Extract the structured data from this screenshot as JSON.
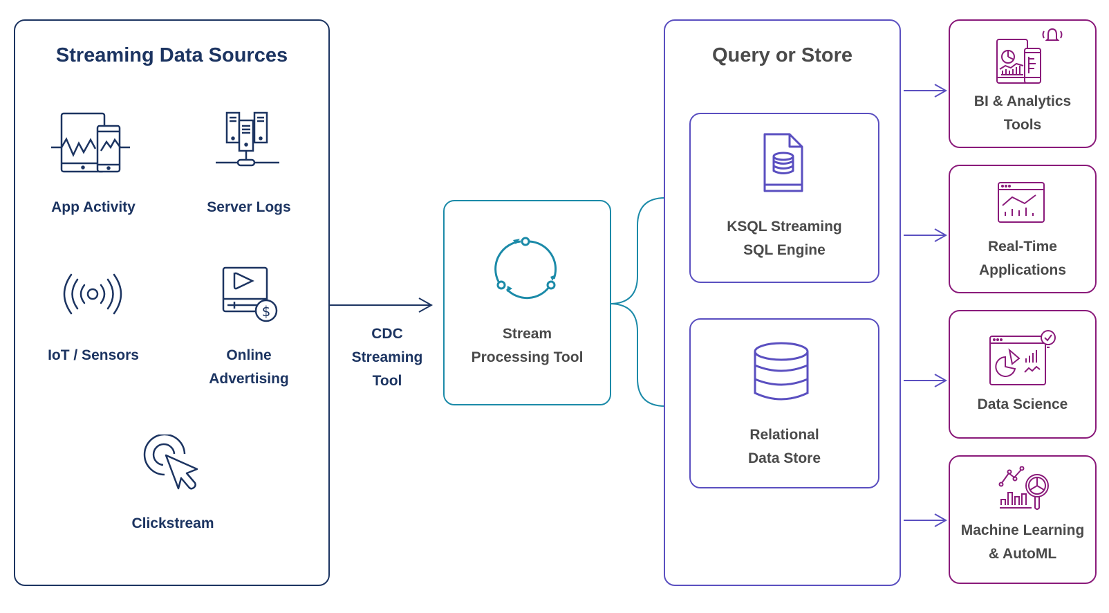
{
  "colors": {
    "navy": "#1c3461",
    "teal": "#1b8aa8",
    "indigo": "#5a4fc0",
    "purple": "#8a1a7a",
    "text_gray": "#4a4a4a"
  },
  "sources": {
    "title": "Streaming Data Sources",
    "items": [
      {
        "label": "App Activity",
        "icon": "app-activity-icon"
      },
      {
        "label": "Server Logs",
        "icon": "server-logs-icon"
      },
      {
        "label": "IoT / Sensors",
        "icon": "iot-sensor-icon"
      },
      {
        "label_line1": "Online",
        "label_line2": "Advertising",
        "icon": "online-advertising-icon"
      },
      {
        "label": "Clickstream",
        "icon": "clickstream-icon"
      }
    ]
  },
  "cdc": {
    "line1": "CDC",
    "line2": "Streaming",
    "line3": "Tool"
  },
  "processing": {
    "line1": "Stream",
    "line2": "Processing Tool",
    "icon": "cycle-icon"
  },
  "query": {
    "title": "Query or Store",
    "ksql": {
      "line1": "KSQL Streaming",
      "line2": "SQL Engine",
      "icon": "database-file-icon"
    },
    "relational": {
      "line1": "Relational",
      "line2": "Data Store",
      "icon": "database-icon"
    }
  },
  "outputs": [
    {
      "line1": "BI & Analytics",
      "line2": "Tools",
      "icon": "bi-analytics-icon"
    },
    {
      "line1": "Real-Time",
      "line2": "Applications",
      "icon": "realtime-dashboard-icon"
    },
    {
      "line1": "Data Science",
      "line2": "",
      "icon": "data-science-icon"
    },
    {
      "line1": "Machine Learning",
      "line2": "& AutoML",
      "icon": "machine-learning-icon"
    }
  ]
}
